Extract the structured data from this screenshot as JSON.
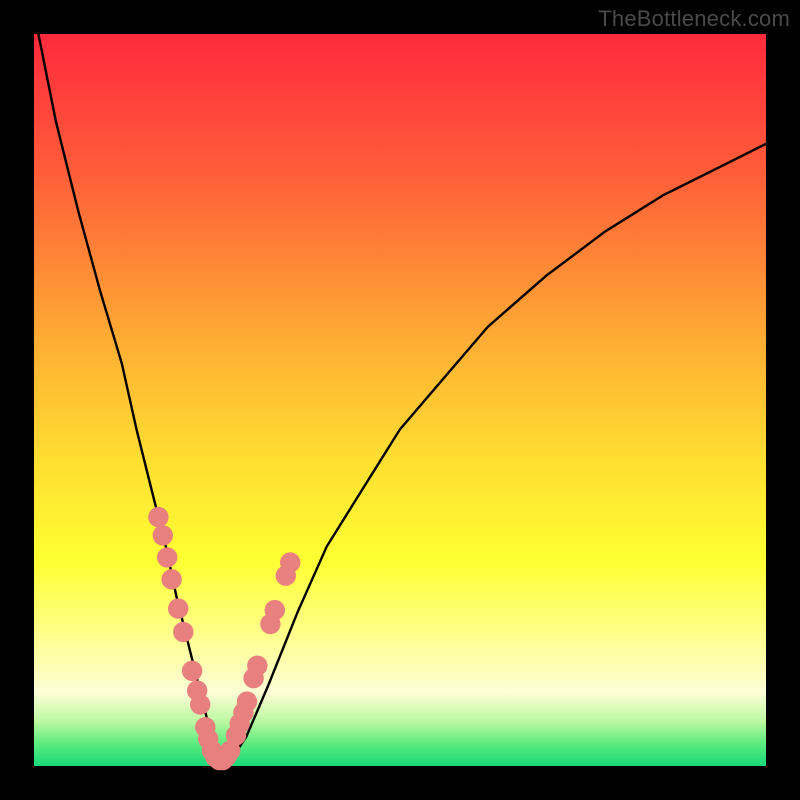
{
  "watermark": "TheBottleneck.com",
  "colors": {
    "background": "#000000",
    "curve": "#000000",
    "bead": "#e98080"
  },
  "chart_data": {
    "type": "line",
    "title": "",
    "xlabel": "",
    "ylabel": "",
    "xlim": [
      0,
      100
    ],
    "ylim": [
      0,
      100
    ],
    "x": [
      0,
      3,
      6,
      9,
      12,
      14,
      16,
      18,
      19.5,
      21,
      22.5,
      23.5,
      24.5,
      25.5,
      27,
      29,
      32,
      36,
      40,
      45,
      50,
      56,
      62,
      70,
      78,
      86,
      94,
      100
    ],
    "values": [
      103,
      88,
      76,
      65,
      55,
      46,
      38,
      30,
      23,
      17,
      11,
      7,
      3,
      1,
      1,
      4,
      11,
      21,
      30,
      38,
      46,
      53,
      60,
      67,
      73,
      78,
      82,
      85
    ],
    "series": [
      {
        "name": "bottleneck-curve",
        "x": [
          0,
          3,
          6,
          9,
          12,
          14,
          16,
          18,
          19.5,
          21,
          22.5,
          23.5,
          24.5,
          25.5,
          27,
          29,
          32,
          36,
          40,
          45,
          50,
          56,
          62,
          70,
          78,
          86,
          94,
          100
        ],
        "y": [
          103,
          88,
          76,
          65,
          55,
          46,
          38,
          30,
          23,
          17,
          11,
          7,
          3,
          1,
          1,
          4,
          11,
          21,
          30,
          38,
          46,
          53,
          60,
          67,
          73,
          78,
          82,
          85
        ]
      }
    ],
    "markers": [
      {
        "cx": 17.0,
        "cy": 34.0,
        "r": 1.4
      },
      {
        "cx": 17.6,
        "cy": 31.5,
        "r": 1.4
      },
      {
        "cx": 18.2,
        "cy": 28.5,
        "r": 1.4
      },
      {
        "cx": 18.8,
        "cy": 25.5,
        "r": 1.4
      },
      {
        "cx": 19.7,
        "cy": 21.5,
        "r": 1.4
      },
      {
        "cx": 20.4,
        "cy": 18.3,
        "r": 1.4
      },
      {
        "cx": 21.6,
        "cy": 13.0,
        "r": 1.4
      },
      {
        "cx": 22.3,
        "cy": 10.3,
        "r": 1.4
      },
      {
        "cx": 22.7,
        "cy": 8.4,
        "r": 1.4
      },
      {
        "cx": 23.4,
        "cy": 5.3,
        "r": 1.4
      },
      {
        "cx": 23.8,
        "cy": 3.7,
        "r": 1.4
      },
      {
        "cx": 24.3,
        "cy": 2.1,
        "r": 1.4
      },
      {
        "cx": 24.8,
        "cy": 1.2,
        "r": 1.4
      },
      {
        "cx": 25.3,
        "cy": 0.8,
        "r": 1.4
      },
      {
        "cx": 25.8,
        "cy": 0.8,
        "r": 1.4
      },
      {
        "cx": 26.3,
        "cy": 1.3,
        "r": 1.4
      },
      {
        "cx": 26.8,
        "cy": 2.1,
        "r": 1.4
      },
      {
        "cx": 27.6,
        "cy": 4.2,
        "r": 1.4
      },
      {
        "cx": 28.1,
        "cy": 5.8,
        "r": 1.4
      },
      {
        "cx": 28.6,
        "cy": 7.3,
        "r": 1.4
      },
      {
        "cx": 29.1,
        "cy": 8.8,
        "r": 1.4
      },
      {
        "cx": 30.0,
        "cy": 12.0,
        "r": 1.4
      },
      {
        "cx": 30.5,
        "cy": 13.7,
        "r": 1.4
      },
      {
        "cx": 32.3,
        "cy": 19.4,
        "r": 1.4
      },
      {
        "cx": 32.9,
        "cy": 21.3,
        "r": 1.4
      },
      {
        "cx": 34.4,
        "cy": 26.0,
        "r": 1.4
      },
      {
        "cx": 35.0,
        "cy": 27.8,
        "r": 1.4
      }
    ]
  }
}
